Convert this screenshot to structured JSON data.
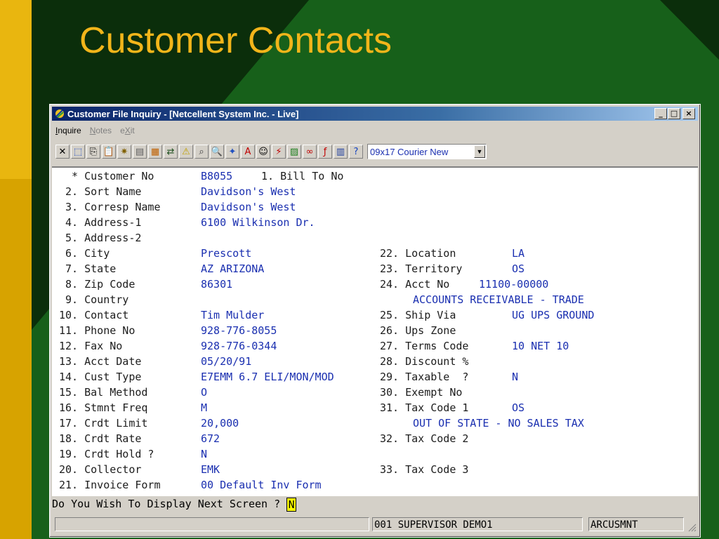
{
  "slide": {
    "title": "Customer Contacts"
  },
  "window": {
    "title": "Customer File Inquiry - [Netcellent System Inc. - Live]",
    "buttons": {
      "minimize": "_",
      "maximize": "□",
      "close": "×"
    }
  },
  "menu": [
    {
      "label_prefix": "",
      "hotkey": "I",
      "label_suffix": "nquire",
      "disabled": false
    },
    {
      "label_prefix": "",
      "hotkey": "N",
      "label_suffix": "otes",
      "disabled": true
    },
    {
      "label_prefix": "e",
      "hotkey": "X",
      "label_suffix": "it",
      "disabled": true
    }
  ],
  "toolbar": {
    "icons": [
      "cancel-icon",
      "select-icon",
      "copy-icon",
      "paste-icon",
      "settings-icon",
      "properties-icon",
      "notes-icon",
      "user-transfer-icon",
      "warning-icon",
      "binoculars-icon",
      "magnifier-icon",
      "wizard-icon",
      "font-icon",
      "contacts-icon",
      "lightning-icon",
      "chart-icon",
      "link-icon",
      "function-icon",
      "document-icon",
      "help-pointer-icon"
    ],
    "glyphs": [
      "✕",
      "⬚",
      "⎘",
      "📋",
      "✷",
      "▤",
      "▦",
      "⇄",
      "⚠",
      "⌕",
      "🔍",
      "✦",
      "A",
      "☺",
      "⚡",
      "▨",
      "∞",
      "ƒ",
      "▥",
      "?"
    ],
    "font_select": "09x17 Courier New"
  },
  "form": {
    "left": [
      {
        "num": "  *",
        "label": "Customer No",
        "value": "B8055",
        "extra": "1. Bill To No"
      },
      {
        "num": " 2.",
        "label": "Sort Name",
        "value": "Davidson's West"
      },
      {
        "num": " 3.",
        "label": "Corresp Name",
        "value": "Davidson's West"
      },
      {
        "num": " 4.",
        "label": "Address-1",
        "value": "6100 Wilkinson Dr."
      },
      {
        "num": " 5.",
        "label": "Address-2",
        "value": ""
      },
      {
        "num": " 6.",
        "label": "City",
        "value": "Prescott"
      },
      {
        "num": " 7.",
        "label": "State",
        "value": "AZ ARIZONA"
      },
      {
        "num": " 8.",
        "label": "Zip Code",
        "value": "86301"
      },
      {
        "num": " 9.",
        "label": "Country",
        "value": ""
      },
      {
        "num": "10.",
        "label": "Contact",
        "value": "Tim Mulder"
      },
      {
        "num": "11.",
        "label": "Phone No",
        "value": "928-776-8055"
      },
      {
        "num": "12.",
        "label": "Fax No",
        "value": "928-776-0344"
      },
      {
        "num": "13.",
        "label": "Acct Date",
        "value": "05/20/91"
      },
      {
        "num": "14.",
        "label": "Cust Type",
        "value": "E7EMM 6.7 ELI/MON/MOD"
      },
      {
        "num": "15.",
        "label": "Bal Method",
        "value": "O"
      },
      {
        "num": "16.",
        "label": "Stmnt Freq",
        "value": "M"
      },
      {
        "num": "17.",
        "label": "Crdt Limit",
        "value": "20,000"
      },
      {
        "num": "18.",
        "label": "Crdt Rate",
        "value": "672"
      },
      {
        "num": "19.",
        "label": "Crdt Hold ?",
        "value": "N"
      },
      {
        "num": "20.",
        "label": "Collector",
        "value": "EMK"
      },
      {
        "num": "21.",
        "label": "Invoice Form",
        "value": "00 Default Inv Form"
      }
    ],
    "right": [
      {
        "row": 5,
        "num": "22.",
        "label": "Location",
        "value": "LA"
      },
      {
        "row": 6,
        "num": "23.",
        "label": "Territory",
        "value": "OS"
      },
      {
        "row": 7,
        "num": "24.",
        "label": "Acct No",
        "value": "11100-00000"
      },
      {
        "row": 8,
        "num": "",
        "label": "",
        "value": "ACCOUNTS RECEIVABLE - TRADE"
      },
      {
        "row": 9,
        "num": "25.",
        "label": "Ship Via",
        "value": "UG UPS GROUND"
      },
      {
        "row": 10,
        "num": "26.",
        "label": "Ups Zone",
        "value": ""
      },
      {
        "row": 11,
        "num": "27.",
        "label": "Terms Code",
        "value": "10 NET 10"
      },
      {
        "row": 12,
        "num": "28.",
        "label": "Discount %",
        "value": ""
      },
      {
        "row": 13,
        "num": "29.",
        "label": "Taxable  ?",
        "value": "N"
      },
      {
        "row": 14,
        "num": "30.",
        "label": "Exempt No",
        "value": ""
      },
      {
        "row": 15,
        "num": "31.",
        "label": "Tax Code 1",
        "value": "OS"
      },
      {
        "row": 16,
        "num": "",
        "label": "",
        "value": "OUT OF STATE - NO SALES TAX"
      },
      {
        "row": 17,
        "num": "32.",
        "label": "Tax Code 2",
        "value": ""
      },
      {
        "row": 19,
        "num": "33.",
        "label": "Tax Code 3",
        "value": ""
      }
    ]
  },
  "prompt": {
    "text": "Do You Wish To Display Next Screen ? ",
    "value": "N"
  },
  "status": {
    "panel1": "",
    "panel2": "001 SUPERVISOR DEMO1",
    "panel3": "ARCUSMNT"
  }
}
